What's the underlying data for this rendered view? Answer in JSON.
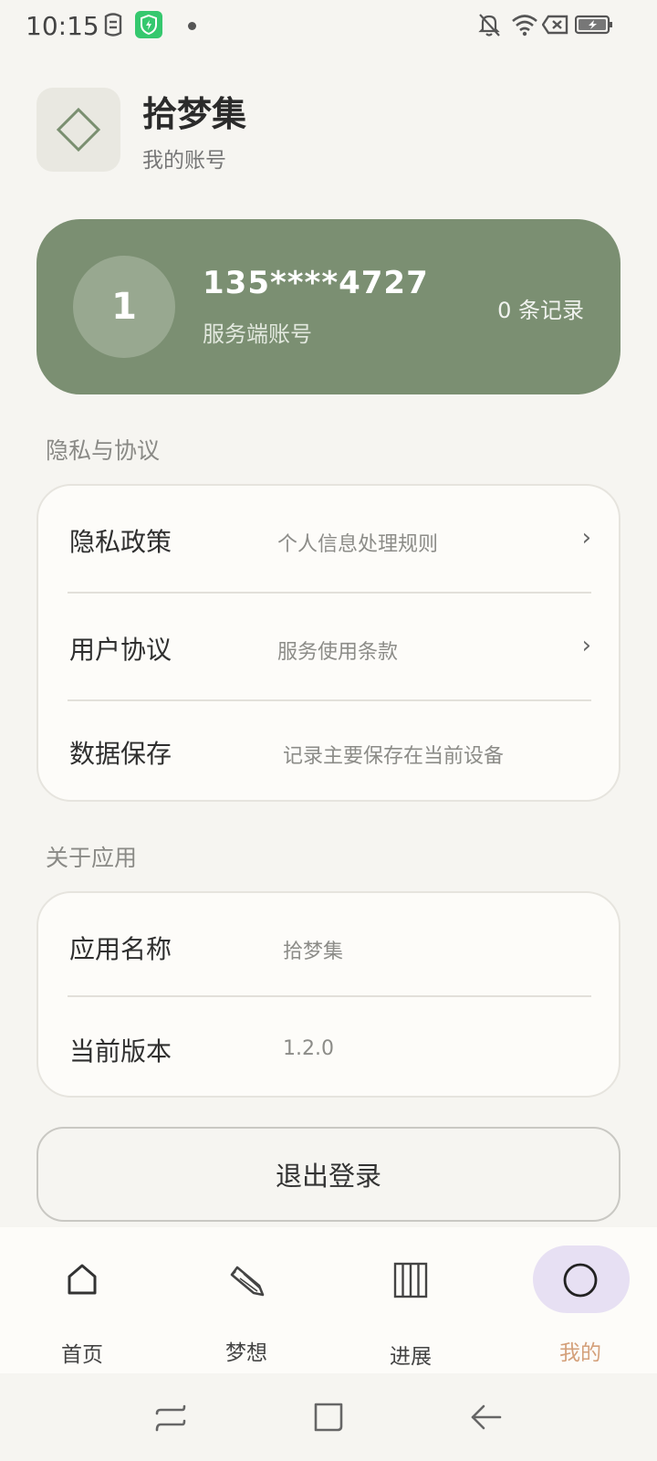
{
  "status_bar": {
    "time": "10:15",
    "icons": [
      "face-icon",
      "shield-icon",
      "notification-dot",
      "bell-off-icon",
      "wifi-icon",
      "sim-x-icon",
      "battery-charging-icon"
    ]
  },
  "header": {
    "logo_icon": "diamond-icon",
    "title": "拾梦集",
    "subtitle": "我的账号"
  },
  "account_card": {
    "avatar_text": "1",
    "phone": "135****4727",
    "account_type": "服务端账号",
    "records": "0 条记录",
    "color": "#7b8f72"
  },
  "privacy_section": {
    "label": "隐私与协议",
    "rows": [
      {
        "title": "隐私政策",
        "desc": "个人信息处理规则",
        "chevron": "›"
      },
      {
        "title": "用户协议",
        "desc": "服务使用条款",
        "chevron": "›"
      },
      {
        "title": "数据保存",
        "desc": "记录主要保存在当前设备"
      }
    ]
  },
  "about_section": {
    "label": "关于应用",
    "rows": [
      {
        "title": "应用名称",
        "value": "拾梦集"
      },
      {
        "title": "当前版本",
        "value": "1.2.0"
      }
    ]
  },
  "logout": {
    "label": "退出登录"
  },
  "bottom_nav": {
    "items": [
      {
        "label": "首页",
        "icon": "home-icon",
        "active": false
      },
      {
        "label": "梦想",
        "icon": "pencil-icon",
        "active": false
      },
      {
        "label": "进展",
        "icon": "columns-icon",
        "active": false
      },
      {
        "label": "我的",
        "icon": "circle-icon",
        "active": true
      }
    ],
    "active_color": "#d4a07a",
    "active_bg": "#e7e0f3"
  },
  "system_nav": {
    "icons": [
      "recents-icon",
      "home-square-icon",
      "back-arrow-icon"
    ]
  }
}
